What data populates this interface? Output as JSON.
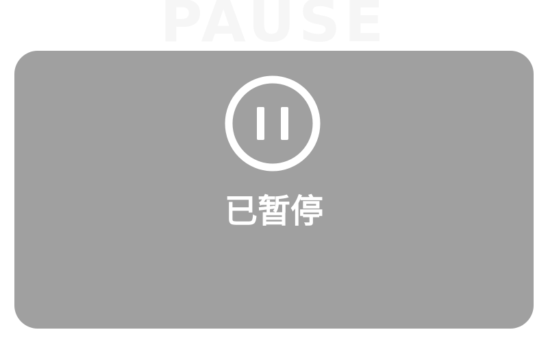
{
  "watermark": {
    "text": "PAUSE"
  },
  "overlay": {
    "status_label": "已暂停",
    "icon": "pause-circle-icon"
  },
  "colors": {
    "page_background": "#ffffff",
    "card_background": "#a0a0a0",
    "foreground": "#ffffff",
    "watermark": "#f6f6f6"
  }
}
